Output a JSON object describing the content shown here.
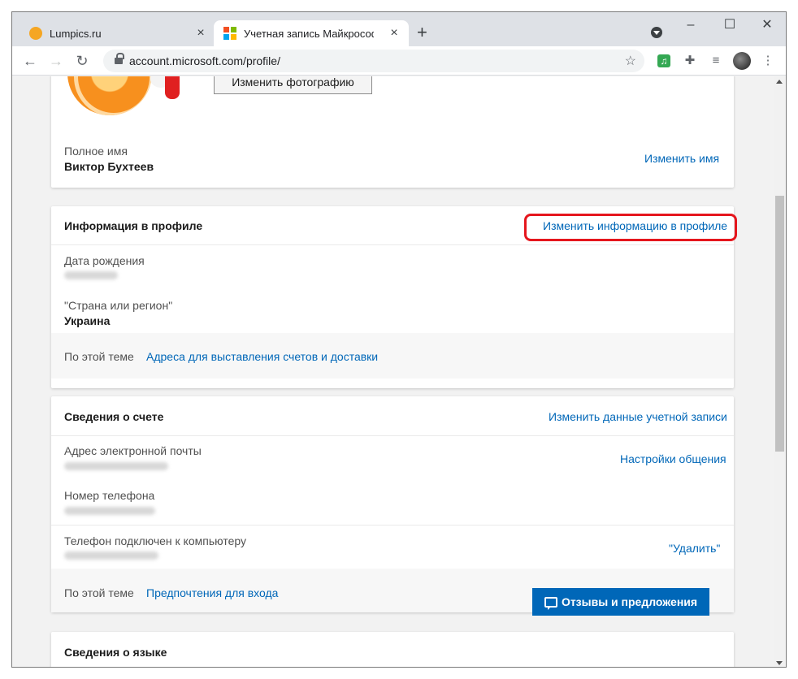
{
  "browser": {
    "tabs": [
      {
        "title": "Lumpics.ru",
        "active": false
      },
      {
        "title": "Учетная запись Майкрософт | Ye",
        "active": true
      }
    ],
    "new_tab_symbol": "+",
    "url": "account.microsoft.com/profile/",
    "window_buttons": {
      "minimize": "–",
      "maximize": "☐",
      "close": "✕"
    }
  },
  "photo_section": {
    "change_photo_label": "Изменить фотографию",
    "full_name_label": "Полное имя",
    "full_name_value": "Виктор Бухтеев",
    "change_name_link": "Изменить имя"
  },
  "profile_info": {
    "title": "Информация в профиле",
    "edit_link": "Изменить информацию в профиле",
    "birthdate_label": "Дата рождения",
    "country_label": "\"Страна или регион\"",
    "country_value": "Украина",
    "related_label": "По этой теме",
    "related_link": "Адреса для выставления счетов и доставки"
  },
  "account_info": {
    "title": "Сведения о счете",
    "edit_link": "Изменить данные учетной записи",
    "email_label": "Адрес электронной почты",
    "comm_link": "Настройки общения",
    "phone_label": "Номер телефона",
    "pc_phone_label": "Телефон подключен к компьютеру",
    "remove_link": "\"Удалить\"",
    "related_label": "По этой теме",
    "related_link": "Предпочтения для входа"
  },
  "language_info": {
    "title": "Сведения о языке"
  },
  "feedback_button": "Отзывы и предложения",
  "icons": [
    "back-arrow-icon",
    "forward-arrow-icon",
    "reload-icon",
    "lock-icon",
    "star-icon",
    "music-extension-icon",
    "puzzle-extensions-icon",
    "media-queue-icon",
    "kebab-menu-icon",
    "feedback-bubble-icon"
  ]
}
